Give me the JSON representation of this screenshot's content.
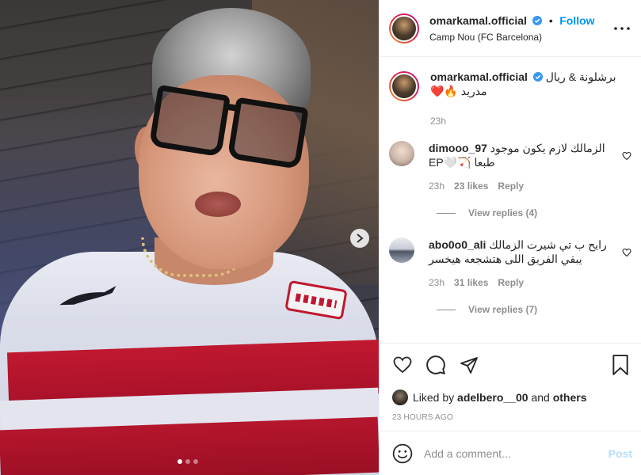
{
  "header": {
    "username": "omarkamal.official",
    "separator": "•",
    "follow_label": "Follow",
    "location": "Camp Nou (FC Barcelona)",
    "more_label": "•••"
  },
  "caption": {
    "username": "omarkamal.official",
    "text_line1": "برشلونة & ريال",
    "text_line2": "مدريد 🔥❤️",
    "time": "23h"
  },
  "comments": [
    {
      "username": "dimooo_97",
      "text_line1": "الزمالك لازم يكون موجود",
      "text_line2": "طبعا 🏹🤍EP",
      "time": "23h",
      "likes": "23 likes",
      "reply_label": "Reply",
      "view_replies": "View replies (4)"
    },
    {
      "username": "abo0o0_ali",
      "text_line1": "رايح ب تي شيرت الزمالك",
      "text_line2": "يبقي الفريق اللى هتشجعه هيخسر",
      "time": "23h",
      "likes": "31 likes",
      "reply_label": "Reply",
      "view_replies": "View replies (7)"
    }
  ],
  "likes": {
    "prefix": "Liked by",
    "user": "adelbero__00",
    "connector": "and",
    "others": "others"
  },
  "posted": "23 HOURS AGO",
  "add_comment": {
    "placeholder": "Add a comment...",
    "post_label": "Post"
  },
  "carousel": {
    "count": 3,
    "active_index": 0
  },
  "colors": {
    "accent": "#0095f6",
    "muted": "#8e8e8e",
    "post_disabled": "#b2dffc"
  },
  "icons": [
    "verified-badge-icon",
    "more-options-icon",
    "heart-icon",
    "comment-icon",
    "share-icon",
    "bookmark-icon",
    "emoji-icon",
    "next-arrow-icon"
  ]
}
